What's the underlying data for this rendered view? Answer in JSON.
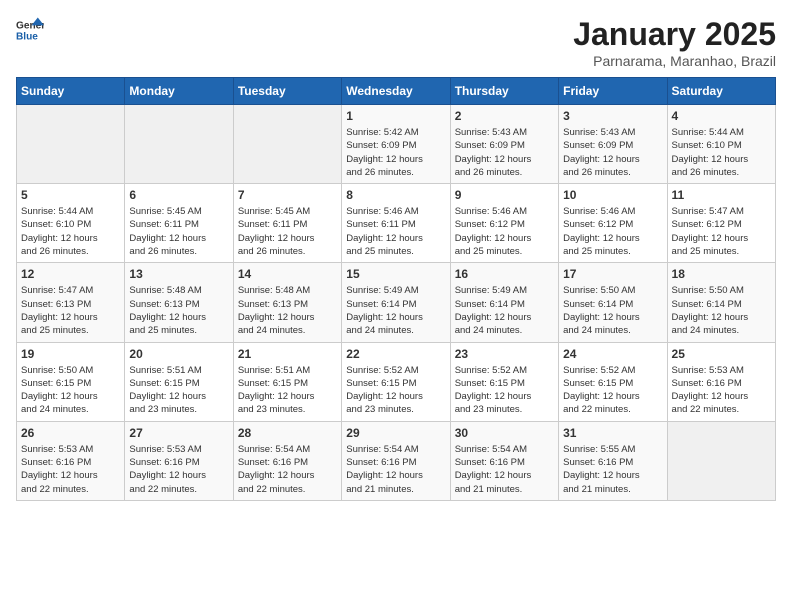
{
  "header": {
    "logo_general": "General",
    "logo_blue": "Blue",
    "title": "January 2025",
    "subtitle": "Parnarama, Maranhao, Brazil"
  },
  "days_of_week": [
    "Sunday",
    "Monday",
    "Tuesday",
    "Wednesday",
    "Thursday",
    "Friday",
    "Saturday"
  ],
  "weeks": [
    [
      {
        "day": "",
        "info": ""
      },
      {
        "day": "",
        "info": ""
      },
      {
        "day": "",
        "info": ""
      },
      {
        "day": "1",
        "info": "Sunrise: 5:42 AM\nSunset: 6:09 PM\nDaylight: 12 hours\nand 26 minutes."
      },
      {
        "day": "2",
        "info": "Sunrise: 5:43 AM\nSunset: 6:09 PM\nDaylight: 12 hours\nand 26 minutes."
      },
      {
        "day": "3",
        "info": "Sunrise: 5:43 AM\nSunset: 6:09 PM\nDaylight: 12 hours\nand 26 minutes."
      },
      {
        "day": "4",
        "info": "Sunrise: 5:44 AM\nSunset: 6:10 PM\nDaylight: 12 hours\nand 26 minutes."
      }
    ],
    [
      {
        "day": "5",
        "info": "Sunrise: 5:44 AM\nSunset: 6:10 PM\nDaylight: 12 hours\nand 26 minutes."
      },
      {
        "day": "6",
        "info": "Sunrise: 5:45 AM\nSunset: 6:11 PM\nDaylight: 12 hours\nand 26 minutes."
      },
      {
        "day": "7",
        "info": "Sunrise: 5:45 AM\nSunset: 6:11 PM\nDaylight: 12 hours\nand 26 minutes."
      },
      {
        "day": "8",
        "info": "Sunrise: 5:46 AM\nSunset: 6:11 PM\nDaylight: 12 hours\nand 25 minutes."
      },
      {
        "day": "9",
        "info": "Sunrise: 5:46 AM\nSunset: 6:12 PM\nDaylight: 12 hours\nand 25 minutes."
      },
      {
        "day": "10",
        "info": "Sunrise: 5:46 AM\nSunset: 6:12 PM\nDaylight: 12 hours\nand 25 minutes."
      },
      {
        "day": "11",
        "info": "Sunrise: 5:47 AM\nSunset: 6:12 PM\nDaylight: 12 hours\nand 25 minutes."
      }
    ],
    [
      {
        "day": "12",
        "info": "Sunrise: 5:47 AM\nSunset: 6:13 PM\nDaylight: 12 hours\nand 25 minutes."
      },
      {
        "day": "13",
        "info": "Sunrise: 5:48 AM\nSunset: 6:13 PM\nDaylight: 12 hours\nand 25 minutes."
      },
      {
        "day": "14",
        "info": "Sunrise: 5:48 AM\nSunset: 6:13 PM\nDaylight: 12 hours\nand 24 minutes."
      },
      {
        "day": "15",
        "info": "Sunrise: 5:49 AM\nSunset: 6:14 PM\nDaylight: 12 hours\nand 24 minutes."
      },
      {
        "day": "16",
        "info": "Sunrise: 5:49 AM\nSunset: 6:14 PM\nDaylight: 12 hours\nand 24 minutes."
      },
      {
        "day": "17",
        "info": "Sunrise: 5:50 AM\nSunset: 6:14 PM\nDaylight: 12 hours\nand 24 minutes."
      },
      {
        "day": "18",
        "info": "Sunrise: 5:50 AM\nSunset: 6:14 PM\nDaylight: 12 hours\nand 24 minutes."
      }
    ],
    [
      {
        "day": "19",
        "info": "Sunrise: 5:50 AM\nSunset: 6:15 PM\nDaylight: 12 hours\nand 24 minutes."
      },
      {
        "day": "20",
        "info": "Sunrise: 5:51 AM\nSunset: 6:15 PM\nDaylight: 12 hours\nand 23 minutes."
      },
      {
        "day": "21",
        "info": "Sunrise: 5:51 AM\nSunset: 6:15 PM\nDaylight: 12 hours\nand 23 minutes."
      },
      {
        "day": "22",
        "info": "Sunrise: 5:52 AM\nSunset: 6:15 PM\nDaylight: 12 hours\nand 23 minutes."
      },
      {
        "day": "23",
        "info": "Sunrise: 5:52 AM\nSunset: 6:15 PM\nDaylight: 12 hours\nand 23 minutes."
      },
      {
        "day": "24",
        "info": "Sunrise: 5:52 AM\nSunset: 6:15 PM\nDaylight: 12 hours\nand 22 minutes."
      },
      {
        "day": "25",
        "info": "Sunrise: 5:53 AM\nSunset: 6:16 PM\nDaylight: 12 hours\nand 22 minutes."
      }
    ],
    [
      {
        "day": "26",
        "info": "Sunrise: 5:53 AM\nSunset: 6:16 PM\nDaylight: 12 hours\nand 22 minutes."
      },
      {
        "day": "27",
        "info": "Sunrise: 5:53 AM\nSunset: 6:16 PM\nDaylight: 12 hours\nand 22 minutes."
      },
      {
        "day": "28",
        "info": "Sunrise: 5:54 AM\nSunset: 6:16 PM\nDaylight: 12 hours\nand 22 minutes."
      },
      {
        "day": "29",
        "info": "Sunrise: 5:54 AM\nSunset: 6:16 PM\nDaylight: 12 hours\nand 21 minutes."
      },
      {
        "day": "30",
        "info": "Sunrise: 5:54 AM\nSunset: 6:16 PM\nDaylight: 12 hours\nand 21 minutes."
      },
      {
        "day": "31",
        "info": "Sunrise: 5:55 AM\nSunset: 6:16 PM\nDaylight: 12 hours\nand 21 minutes."
      },
      {
        "day": "",
        "info": ""
      }
    ]
  ]
}
